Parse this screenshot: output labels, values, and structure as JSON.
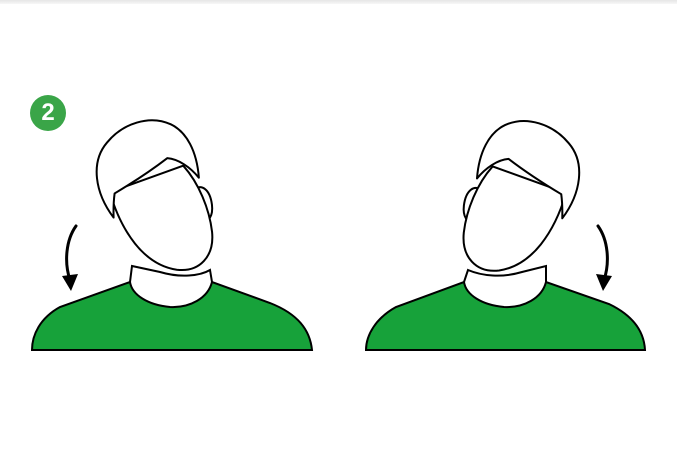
{
  "step": {
    "number": "2",
    "badge_color": "#3aa548"
  },
  "illustration": {
    "shirt_color": "#17a23a",
    "outline_color": "#000000",
    "figures": [
      {
        "id": "left",
        "head_tilt": "left",
        "arrow_icon": "curved-arrow-down-icon",
        "arrow_side": "left"
      },
      {
        "id": "right",
        "head_tilt": "right",
        "arrow_icon": "curved-arrow-down-icon",
        "arrow_side": "right"
      }
    ]
  }
}
